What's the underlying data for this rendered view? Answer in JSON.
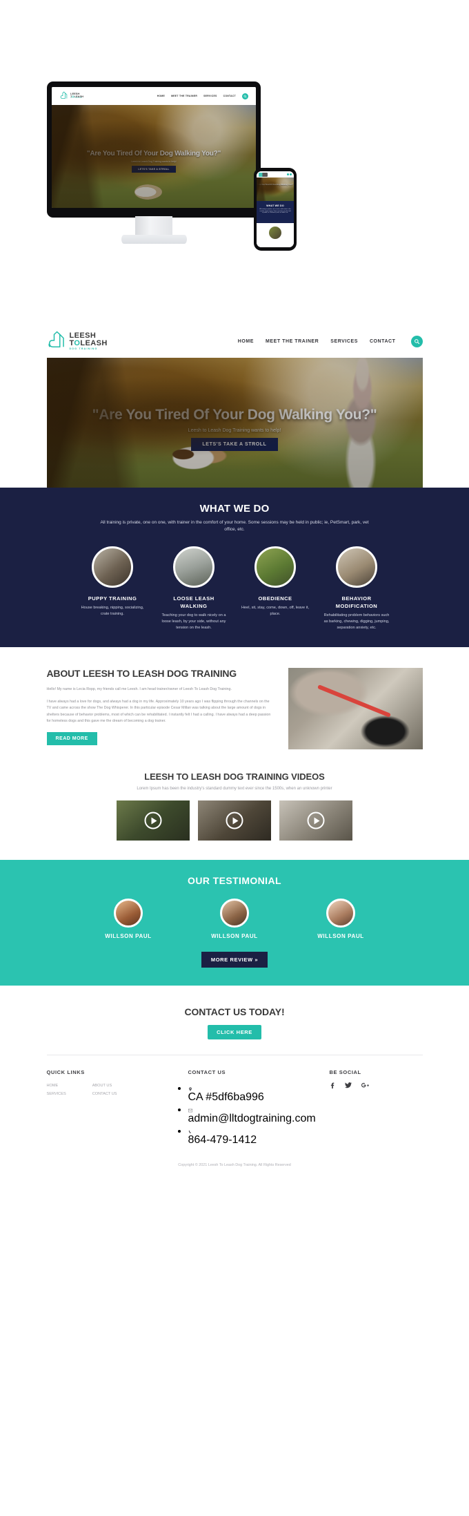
{
  "brand": {
    "logo_line1": "LEESH",
    "logo_line2_a": "T",
    "logo_line2_o": "O",
    "logo_line2_b": "LEASH",
    "logo_tagline": "DOG TRAINING"
  },
  "nav": {
    "items": [
      {
        "label": "HOME"
      },
      {
        "label": "MEET THE TRAINER"
      },
      {
        "label": "SERVICES"
      },
      {
        "label": "CONTACT"
      }
    ],
    "search_icon": "search-icon"
  },
  "hero": {
    "heading": "\"Are You Tired Of Your Dog Walking You?\"",
    "subheading": "Leesh to Leash Dog Training wants to help!",
    "button": "LETS'S TAKE A STROLL"
  },
  "what_we_do": {
    "title": "WHAT WE DO",
    "lead": "All training is private, one on one, with trainer in the comfort of your home. Some sessions may be held in public; ie, PetSmart, park, vet office, etc.",
    "cards": [
      {
        "title": "PUPPY TRAINING",
        "text": "House breaking, nipping, socializing, crate training."
      },
      {
        "title": "LOOSE LEASH WALKING",
        "text": "Teaching your dog to walk nicely on a loose leash, by your side, without any tension on the leash."
      },
      {
        "title": "OBEDIENCE",
        "text": "Heel, sit, stay, come, down, off, leave it, place."
      },
      {
        "title": "BEHAVIOR MODIFICATION",
        "text": "Rehabilitating problem behaviors such as barking, chewing, digging, jumping, separation anxiety, etc."
      }
    ]
  },
  "about": {
    "title": "ABOUT LEESH TO LEASH DOG TRAINING",
    "paragraph1": "Hello!  My name is Lecia Ropp, my friends call me Leesh.  I am head trainer/owner of Leesh To Leash Dog Training.",
    "paragraph2": "I have always had a love for dogs, and always had a dog in my life. Approximately 10 years ago I was flipping through the channels on the TV and came across the show The Dog Whisperer.  In this particular episode Cesar Millan was talking about the large amount of dogs in shelters because of behavior problems, most of which can be rehabilitated.  I instantly felt I had a calling.  I have always had a deep passion for homeless dogs and this gave me the dream of becoming a dog trainer.",
    "button": "READ MORE"
  },
  "videos": {
    "title": "LEESH TO LEASH DOG TRAINING VIDEOS",
    "subtitle": "Lorem Ipsum has been the industry's standard dummy text ever since the 1500s, when an unknown printer",
    "items": [
      {
        "play_icon": "play-icon"
      },
      {
        "play_icon": "play-icon"
      },
      {
        "play_icon": "play-icon"
      }
    ]
  },
  "testimonial": {
    "title": "OUR TESTIMONIAL",
    "people": [
      {
        "name": "WILLSON PAUL"
      },
      {
        "name": "WILLSON PAUL"
      },
      {
        "name": "WILLSON PAUL"
      }
    ],
    "button": "MORE REVIEW »"
  },
  "cta": {
    "title": "CONTACT US TODAY!",
    "button": "CLICK HERE"
  },
  "footer": {
    "quick_links": {
      "title": "QUICK LINKS",
      "col1": [
        "HOME",
        "SERVICES"
      ],
      "col2": [
        "ABOUT US",
        "CONTACT US"
      ]
    },
    "contact_us": {
      "title": "CONTACT US",
      "items": [
        {
          "icon": "location-pin-icon",
          "text": "CA #5df6ba996"
        },
        {
          "icon": "envelope-icon",
          "text": "admin@lltdogtraining.com"
        },
        {
          "icon": "phone-icon",
          "text": "864-479-1412"
        }
      ]
    },
    "be_social": {
      "title": "BE SOCIAL",
      "icons": [
        "facebook-icon",
        "twitter-icon",
        "google-plus-icon"
      ]
    },
    "copyright": "Copyright © 2021 Leesh To Leash Dog Training. All Rights Reserved"
  },
  "colors": {
    "teal": "#23bdaa",
    "navy": "#1b2043",
    "testimonial_bg": "#2bc3b0"
  }
}
